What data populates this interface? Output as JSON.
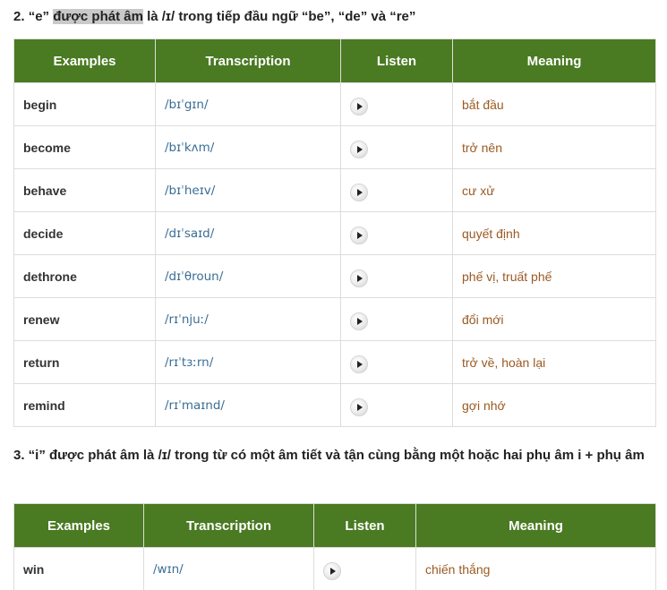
{
  "section2": {
    "number": "2. ",
    "quote_e": "“e” ",
    "highlight": "được phát âm",
    "rest": " là /ɪ/ trong tiếp đầu ngữ “be”, “de” và “re”",
    "table": {
      "headers": [
        "Examples",
        "Transcription",
        "Listen",
        "Meaning"
      ],
      "rows": [
        {
          "word": "begin",
          "ipa": "/bɪˈgɪn/",
          "meaning": "bắt đầu"
        },
        {
          "word": "become",
          "ipa": "/bɪˈkʌm/",
          "meaning": "trở nên"
        },
        {
          "word": "behave",
          "ipa": "/bɪˈheɪv/",
          "meaning": "cư xử"
        },
        {
          "word": "decide",
          "ipa": "/dɪˈsaɪd/",
          "meaning": "quyết định"
        },
        {
          "word": "dethrone",
          "ipa": "/dɪˈθroun/",
          "meaning": "phế vị, truất phế"
        },
        {
          "word": "renew",
          "ipa": "/rɪˈnjuː/",
          "meaning": "đổi mới"
        },
        {
          "word": "return",
          "ipa": "/rɪˈtɜːrn/",
          "meaning": "trở về, hoàn lại"
        },
        {
          "word": "remind",
          "ipa": "/rɪˈmaɪnd/",
          "meaning": "gợi nhớ"
        }
      ]
    }
  },
  "section3": {
    "title": "3. “i” được phát âm là /ɪ/ trong từ có một âm tiết và tận cùng bằng một hoặc hai phụ âm i + phụ âm",
    "table": {
      "headers": [
        "Examples",
        "Transcription",
        "Listen",
        "Meaning"
      ],
      "rows": [
        {
          "word": "win",
          "ipa": "/wɪn/",
          "meaning": "chiến thắng"
        }
      ]
    }
  },
  "icons": {
    "listen": "play-icon"
  }
}
